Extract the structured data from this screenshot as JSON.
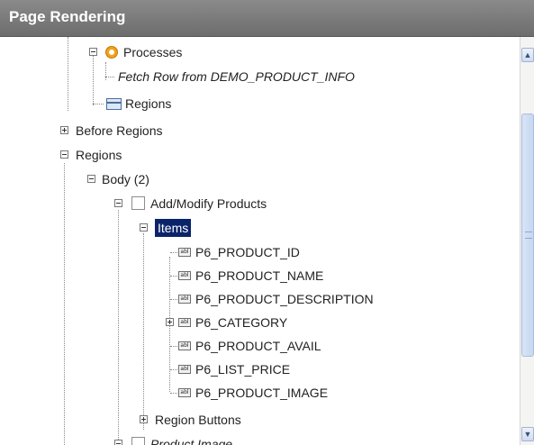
{
  "header": {
    "title": "Page Rendering"
  },
  "tree": {
    "processes": "Processes",
    "fetch_row": "Fetch Row from DEMO_PRODUCT_INFO",
    "regions_child": "Regions",
    "before_regions": "Before Regions",
    "regions": "Regions",
    "body": "Body (2)",
    "add_modify_products": "Add/Modify Products",
    "items": "Items",
    "item_icon_text": "abl",
    "items_list": [
      "P6_PRODUCT_ID",
      "P6_PRODUCT_NAME",
      "P6_PRODUCT_DESCRIPTION",
      "P6_CATEGORY",
      "P6_PRODUCT_AVAIL",
      "P6_LIST_PRICE",
      "P6_PRODUCT_IMAGE"
    ],
    "region_buttons": "Region Buttons",
    "product_image": "Product Image"
  },
  "scrollbar": {
    "up": "▲",
    "down": "▼"
  },
  "colors": {
    "header_bg": "#7a7a7a",
    "selected_bg": "#0a246a"
  }
}
